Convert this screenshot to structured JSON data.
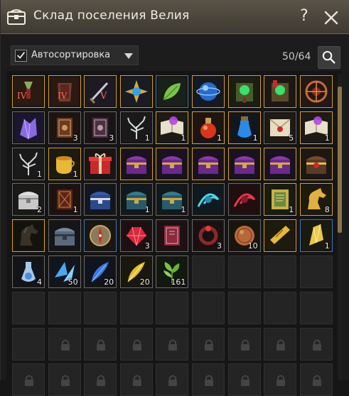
{
  "window": {
    "title": "Склад поселения Велия",
    "help_label": "?"
  },
  "toolbar": {
    "autosort_label": "Автосортировка",
    "autosort_checked": true,
    "capacity": "50/64"
  },
  "colors": {
    "rarity_normal": "#6a6a6a",
    "rarity_green": "#7f8a3a",
    "rarity_blue": "#3f78b8",
    "rarity_yellow": "#d1a22a",
    "rarity_orange": "#d76b2a",
    "scrollbar": "#8a7448"
  },
  "grid": {
    "columns": 9,
    "slots": [
      {
        "icon": "accessory-iv-icon",
        "rarity": "yellow",
        "qty": ""
      },
      {
        "icon": "armor-iv-icon",
        "rarity": "yellow",
        "qty": ""
      },
      {
        "icon": "weapon-v-icon",
        "rarity": "yellow",
        "qty": ""
      },
      {
        "icon": "blue-star-crystal-icon",
        "rarity": "yellow",
        "qty": ""
      },
      {
        "icon": "green-leaf-icon",
        "rarity": "blue",
        "qty": ""
      },
      {
        "icon": "blue-orb-icon",
        "rarity": "yellow",
        "qty": ""
      },
      {
        "icon": "green-gem-scroll-icon",
        "rarity": "yellow",
        "qty": ""
      },
      {
        "icon": "green-gem-scroll-red-icon",
        "rarity": "yellow",
        "qty": ""
      },
      {
        "icon": "rune-amulet-icon",
        "rarity": "yellow",
        "qty": ""
      },
      {
        "icon": "purple-crystal-icon",
        "rarity": "normal",
        "qty": ""
      },
      {
        "icon": "brown-book-icon",
        "rarity": "normal",
        "qty": "3"
      },
      {
        "icon": "dark-book-icon",
        "rarity": "normal",
        "qty": "3"
      },
      {
        "icon": "silver-tree-icon",
        "rarity": "normal",
        "qty": "1"
      },
      {
        "icon": "open-book-purple-icon",
        "rarity": "yellow",
        "qty": "1"
      },
      {
        "icon": "red-potion-icon",
        "rarity": "yellow",
        "qty": "1"
      },
      {
        "icon": "blue-vial-icon",
        "rarity": "yellow",
        "qty": "1"
      },
      {
        "icon": "letter-icon",
        "rarity": "normal",
        "qty": "5"
      },
      {
        "icon": "open-book-purple-icon",
        "rarity": "yellow",
        "qty": "1"
      },
      {
        "icon": "silver-tree-icon",
        "rarity": "normal",
        "qty": "1"
      },
      {
        "icon": "tea-cup-icon",
        "rarity": "yellow",
        "qty": "1"
      },
      {
        "icon": "gift-box-icon",
        "rarity": "normal",
        "qty": ""
      },
      {
        "icon": "purple-chest-icon",
        "rarity": "yellow",
        "qty": ""
      },
      {
        "icon": "purple-chest-icon",
        "rarity": "yellow",
        "qty": ""
      },
      {
        "icon": "purple-chest-icon",
        "rarity": "yellow",
        "qty": ""
      },
      {
        "icon": "purple-chest-icon",
        "rarity": "yellow",
        "qty": ""
      },
      {
        "icon": "purple-chest-icon",
        "rarity": "yellow",
        "qty": ""
      },
      {
        "icon": "gold-chest-icon",
        "rarity": "yellow",
        "qty": ""
      },
      {
        "icon": "white-chest-icon",
        "rarity": "normal",
        "qty": "2"
      },
      {
        "icon": "red-tome-icon",
        "rarity": "normal",
        "qty": "1"
      },
      {
        "icon": "blue-chest-icon",
        "rarity": "normal",
        "qty": ""
      },
      {
        "icon": "teal-chest-icon",
        "rarity": "normal",
        "qty": "1"
      },
      {
        "icon": "teal-chest-icon",
        "rarity": "normal",
        "qty": "1"
      },
      {
        "icon": "cyan-swirl-icon",
        "rarity": "normal",
        "qty": ""
      },
      {
        "icon": "red-swirl-icon",
        "rarity": "normal",
        "qty": ""
      },
      {
        "icon": "green-scroll-icon",
        "rarity": "yellow",
        "qty": "1"
      },
      {
        "icon": "golden-horse-icon",
        "rarity": "yellow",
        "qty": "8"
      },
      {
        "icon": "dark-horse-icon",
        "rarity": "yellow",
        "qty": ""
      },
      {
        "icon": "steel-chest-icon",
        "rarity": "normal",
        "qty": ""
      },
      {
        "icon": "compass-icon",
        "rarity": "blue",
        "qty": ""
      },
      {
        "icon": "red-gem-icon",
        "rarity": "normal",
        "qty": "3"
      },
      {
        "icon": "crimson-tome-icon",
        "rarity": "normal",
        "qty": ""
      },
      {
        "icon": "red-ring-icon",
        "rarity": "normal",
        "qty": "3"
      },
      {
        "icon": "copper-coin-icon",
        "rarity": "normal",
        "qty": "10"
      },
      {
        "icon": "gold-ticket-icon",
        "rarity": "yellow",
        "qty": ""
      },
      {
        "icon": "gold-shard-icon",
        "rarity": "blue",
        "qty": "1"
      },
      {
        "icon": "spirit-flask-icon",
        "rarity": "normal",
        "qty": "4"
      },
      {
        "icon": "blue-shards-icon",
        "rarity": "normal",
        "qty": "50"
      },
      {
        "icon": "blue-feather-icon",
        "rarity": "normal",
        "qty": "20"
      },
      {
        "icon": "yellow-feather-icon",
        "rarity": "normal",
        "qty": "20"
      },
      {
        "icon": "herb-icon",
        "rarity": "normal",
        "qty": "161"
      },
      {
        "icon": "",
        "rarity": "empty",
        "qty": ""
      },
      {
        "icon": "",
        "rarity": "empty",
        "qty": ""
      },
      {
        "icon": "",
        "rarity": "empty",
        "qty": ""
      },
      {
        "icon": "",
        "rarity": "empty",
        "qty": ""
      },
      {
        "icon": "",
        "rarity": "empty",
        "qty": ""
      },
      {
        "icon": "",
        "rarity": "empty",
        "qty": ""
      },
      {
        "icon": "",
        "rarity": "empty",
        "qty": ""
      },
      {
        "icon": "",
        "rarity": "empty",
        "qty": ""
      },
      {
        "icon": "",
        "rarity": "empty",
        "qty": ""
      },
      {
        "icon": "",
        "rarity": "empty",
        "qty": ""
      },
      {
        "icon": "",
        "rarity": "empty",
        "qty": ""
      },
      {
        "icon": "",
        "rarity": "empty",
        "qty": ""
      },
      {
        "icon": "",
        "rarity": "empty",
        "qty": ""
      },
      {
        "icon": "",
        "rarity": "empty",
        "qty": ""
      },
      {
        "icon": "lock-icon",
        "rarity": "locked",
        "qty": ""
      },
      {
        "icon": "lock-icon",
        "rarity": "locked",
        "qty": ""
      },
      {
        "icon": "lock-icon",
        "rarity": "locked",
        "qty": ""
      },
      {
        "icon": "lock-icon",
        "rarity": "locked",
        "qty": ""
      },
      {
        "icon": "lock-icon",
        "rarity": "locked",
        "qty": ""
      },
      {
        "icon": "lock-icon",
        "rarity": "locked",
        "qty": ""
      },
      {
        "icon": "lock-icon",
        "rarity": "locked",
        "qty": ""
      },
      {
        "icon": "lock-icon",
        "rarity": "locked",
        "qty": ""
      },
      {
        "icon": "lock-icon",
        "rarity": "locked",
        "qty": ""
      },
      {
        "icon": "lock-icon",
        "rarity": "locked",
        "qty": ""
      },
      {
        "icon": "lock-icon",
        "rarity": "locked",
        "qty": ""
      },
      {
        "icon": "lock-icon",
        "rarity": "locked",
        "qty": ""
      },
      {
        "icon": "lock-icon",
        "rarity": "locked",
        "qty": ""
      },
      {
        "icon": "lock-icon",
        "rarity": "locked",
        "qty": ""
      },
      {
        "icon": "lock-icon",
        "rarity": "locked",
        "qty": ""
      },
      {
        "icon": "lock-icon",
        "rarity": "locked",
        "qty": ""
      },
      {
        "icon": "lock-icon",
        "rarity": "locked",
        "qty": ""
      }
    ]
  }
}
